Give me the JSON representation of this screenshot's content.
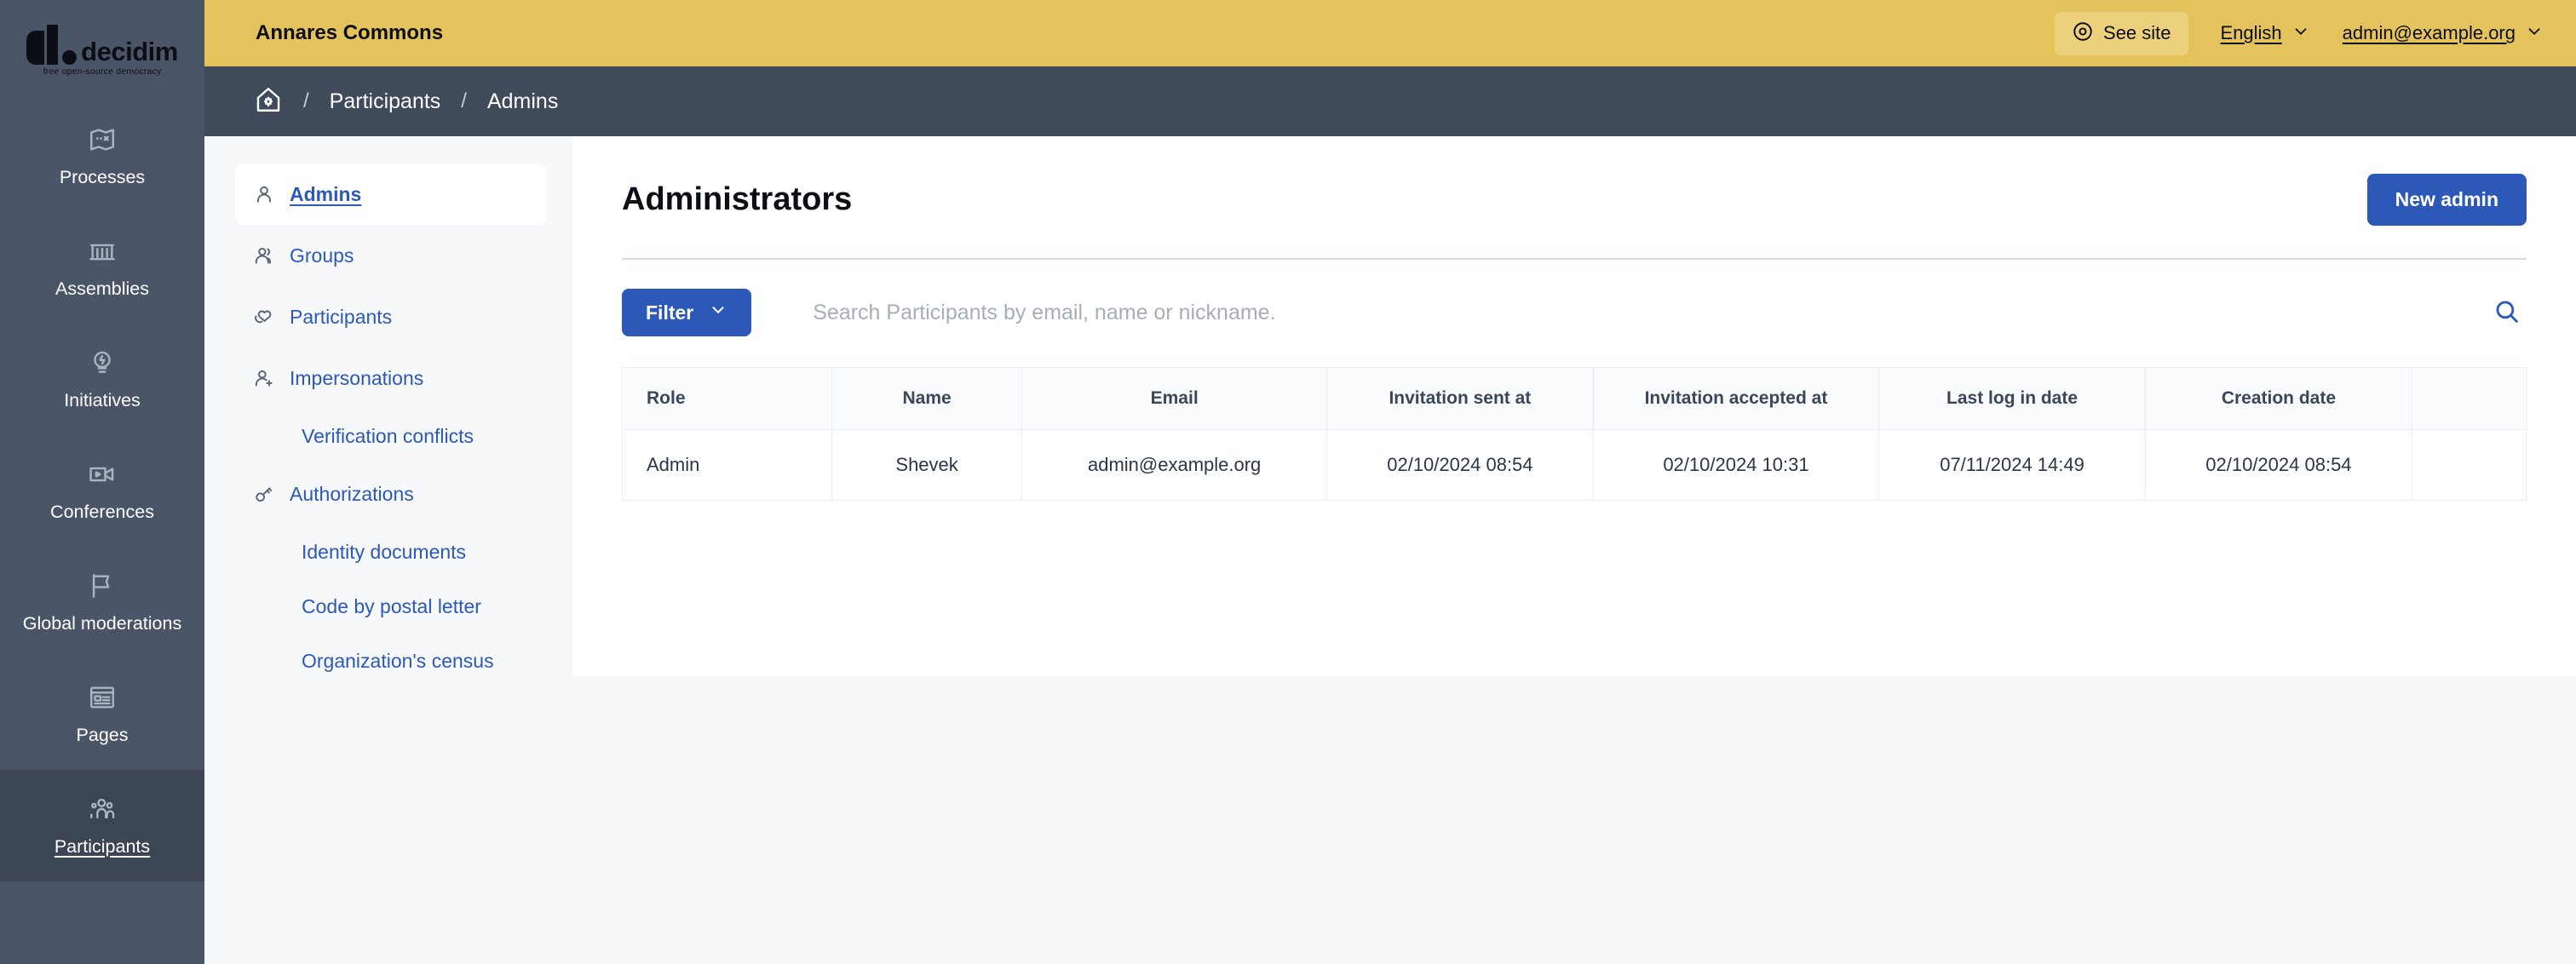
{
  "brand": {
    "logo_word": "decidim",
    "logo_tagline": "free open-source democracy",
    "accent_blue": "#2c59b8",
    "topbar_yellow": "#e5c35c",
    "rail_bg": "#4a5568",
    "crumb_bg": "#3f4a5a"
  },
  "topbar": {
    "org_title": "Annares Commons",
    "see_site_label": "See site",
    "language_label": "English",
    "account_label": "admin@example.org"
  },
  "breadcrumb": {
    "home_icon": "home-gear-icon",
    "separator": "/",
    "items": [
      {
        "label": "Participants"
      },
      {
        "label": "Admins"
      }
    ]
  },
  "rail": {
    "items": [
      {
        "label": "Processes",
        "icon": "map-icon",
        "active": false
      },
      {
        "label": "Assemblies",
        "icon": "bank-icon",
        "active": false
      },
      {
        "label": "Initiatives",
        "icon": "lightbulb-icon",
        "active": false
      },
      {
        "label": "Conferences",
        "icon": "video-icon",
        "active": false
      },
      {
        "label": "Global moderations",
        "icon": "flag-icon",
        "active": false
      },
      {
        "label": "Pages",
        "icon": "page-icon",
        "active": false
      },
      {
        "label": "Participants",
        "icon": "people-icon",
        "active": true
      }
    ]
  },
  "subnav": {
    "items": [
      {
        "label": "Admins",
        "icon": "user-icon",
        "active": true,
        "sub": false
      },
      {
        "label": "Groups",
        "icon": "users-icon",
        "active": false,
        "sub": false
      },
      {
        "label": "Participants",
        "icon": "heart-hand-icon",
        "active": false,
        "sub": false
      },
      {
        "label": "Impersonations",
        "icon": "user-add-icon",
        "active": false,
        "sub": false
      },
      {
        "label": "Verification conflicts",
        "icon": "",
        "active": false,
        "sub": true
      },
      {
        "label": "Authorizations",
        "icon": "key-icon",
        "active": false,
        "sub": false
      },
      {
        "label": "Identity documents",
        "icon": "",
        "active": false,
        "sub": true
      },
      {
        "label": "Code by postal letter",
        "icon": "",
        "active": false,
        "sub": true
      },
      {
        "label": "Organization's census",
        "icon": "",
        "active": false,
        "sub": true
      }
    ]
  },
  "main": {
    "page_title": "Administrators",
    "new_admin_label": "New admin",
    "filter_label": "Filter",
    "search_placeholder": "Search Participants by email, name or nickname.",
    "search_value": "",
    "search_icon": "search-icon",
    "table": {
      "columns": [
        "Role",
        "Name",
        "Email",
        "Invitation sent at",
        "Invitation accepted at",
        "Last log in date",
        "Creation date",
        ""
      ],
      "rows": [
        {
          "role": "Admin",
          "name": "Shevek",
          "email": "admin@example.org",
          "invitation_sent_at": "02/10/2024 08:54",
          "invitation_accepted_at": "02/10/2024 10:31",
          "last_log_in_date": "07/11/2024 14:49",
          "creation_date": "02/10/2024 08:54",
          "actions": ""
        }
      ]
    }
  }
}
